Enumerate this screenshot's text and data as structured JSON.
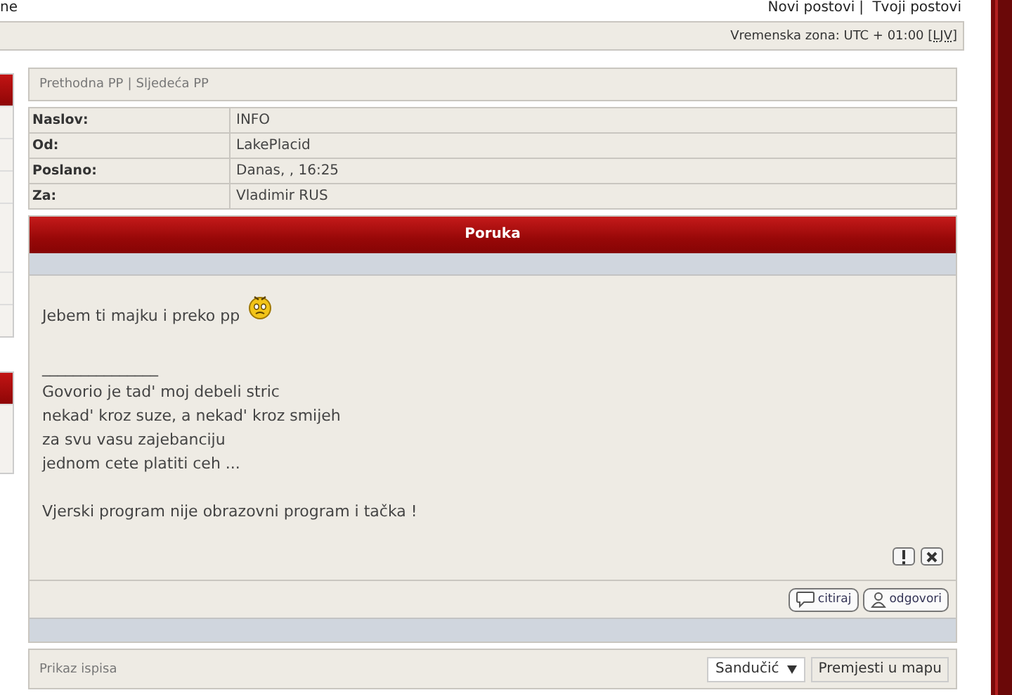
{
  "top_bar": {
    "left_fragment": "ne",
    "links": [
      "Novi postovi",
      "Tvoji postovi"
    ],
    "separator": "|"
  },
  "timezone": {
    "label": "Vremenska zona: UTC + 01:00",
    "abbr": "[LJV]"
  },
  "pm_nav": {
    "links": [
      "Prethodna PP",
      "Sljedeća PP"
    ],
    "separator": "|"
  },
  "header_fields": [
    {
      "label": "Naslov:",
      "value": "INFO"
    },
    {
      "label": "Od:",
      "value": "LakePlacid"
    },
    {
      "label": "Poslano:",
      "value": "Danas, , 16:25"
    },
    {
      "label": "Za:",
      "value": "Vladimir RUS"
    }
  ],
  "message": {
    "title": "Poruka",
    "opening": "Jebem ti majku i preko pp",
    "signature": [
      "_______________",
      "Govorio je tad' moj debeli stric",
      "nekad' kroz suze, a nekad' kroz smijeh",
      "za svu vasu zajebanciju",
      "jednom cete platiti ceh ..."
    ],
    "closing": "Vjerski program nije obrazovni program i tačka !"
  },
  "post_buttons": [
    "citiraj",
    "odgovori"
  ],
  "footer": {
    "print_link": "Prikaz ispisa",
    "folder_select": "Sandučić",
    "move_button": "Premjesti u mapu"
  }
}
